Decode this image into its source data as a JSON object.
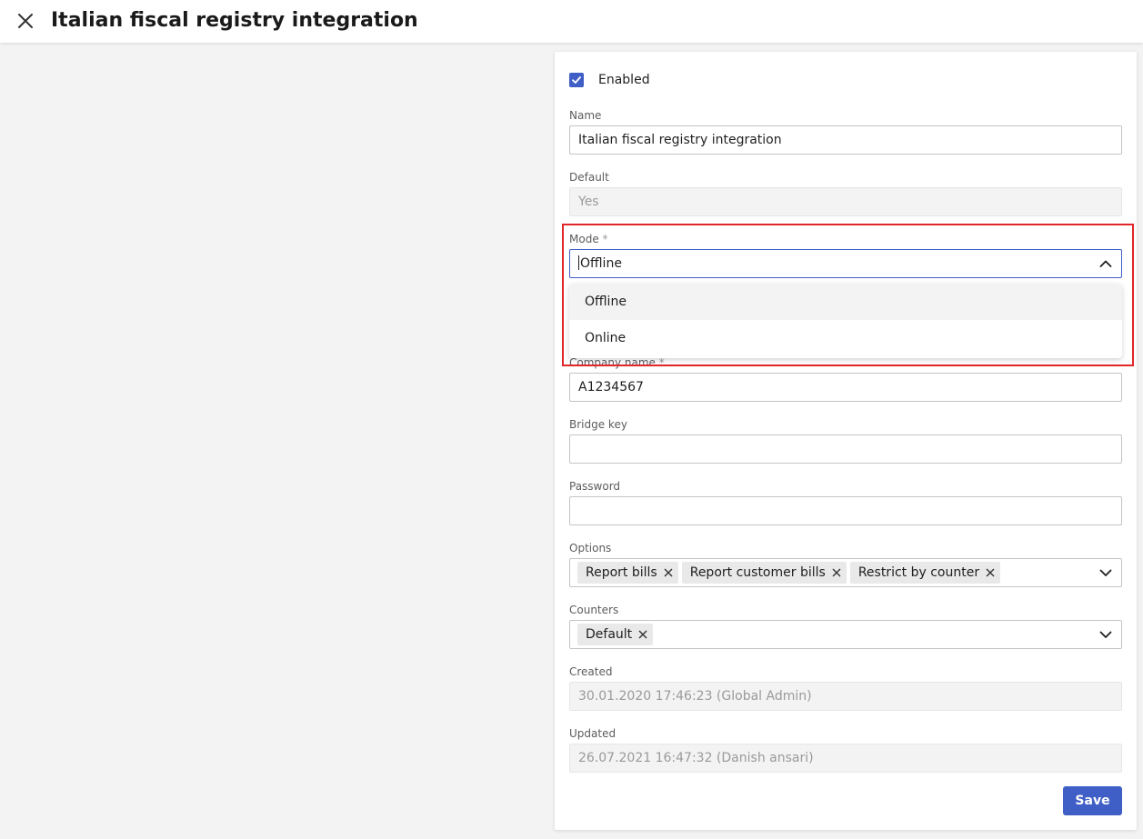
{
  "header": {
    "title": "Italian fiscal registry integration",
    "close_icon": "close-icon"
  },
  "form": {
    "enabled": {
      "label": "Enabled",
      "checked": true
    },
    "name": {
      "label": "Name",
      "value": "Italian fiscal registry integration"
    },
    "default": {
      "label": "Default",
      "value": "Yes"
    },
    "mode": {
      "label": "Mode",
      "required_mark": "*",
      "value": "Offline",
      "options": [
        "Offline",
        "Online"
      ]
    },
    "company_name": {
      "label": "Company name",
      "required_mark": "*",
      "value": "A1234567"
    },
    "bridge_key": {
      "label": "Bridge key",
      "value": ""
    },
    "password": {
      "label": "Password",
      "value": ""
    },
    "options": {
      "label": "Options",
      "chips": [
        "Report bills",
        "Report customer bills",
        "Restrict by counter"
      ]
    },
    "counters": {
      "label": "Counters",
      "chips": [
        "Default"
      ]
    },
    "created": {
      "label": "Created",
      "value": "30.01.2020 17:46:23 (Global Admin)"
    },
    "updated": {
      "label": "Updated",
      "value": "26.07.2021 16:47:32 (Danish ansari)"
    },
    "save_label": "Save"
  },
  "colors": {
    "accent": "#3f5fc6",
    "highlight_border": "#e0262b",
    "page_background": "#f3f3f3"
  }
}
